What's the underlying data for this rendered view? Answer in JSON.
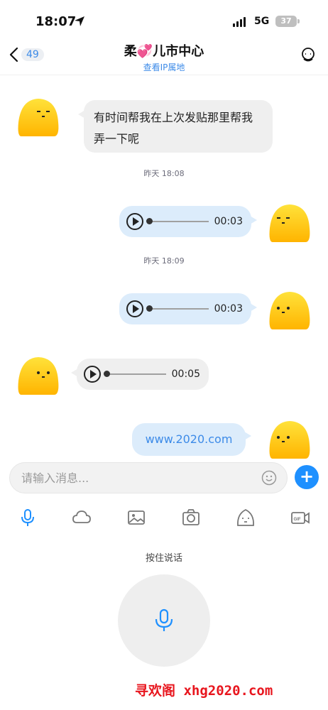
{
  "status_bar": {
    "time": "18:07",
    "network": "5G",
    "battery": "37"
  },
  "header": {
    "back_badge": "49",
    "title_prefix": "柔",
    "title_suffix": "儿市中心",
    "subtitle": "查看IP属地"
  },
  "messages": {
    "m1_text": "有时间帮我在上次发贴那里帮我弄一下呢",
    "ts1": "昨天 18:08",
    "voice1_duration": "00:03",
    "ts2": "昨天 18:09",
    "voice2_duration": "00:03",
    "voice3_duration": "00:05",
    "link_text": "www.2020.com"
  },
  "input": {
    "placeholder": "请输入消息..."
  },
  "toolbar": {
    "items": [
      "mic-icon",
      "cloud-icon",
      "image-icon",
      "camera-icon",
      "emoji-icon",
      "gif-icon"
    ],
    "active_color": "#1e90ff"
  },
  "voice_panel": {
    "hint": "按住说话"
  },
  "watermark": {
    "text": "寻欢阁 xhg2020.com"
  },
  "colors": {
    "accent": "#1e90ff",
    "bubble_mine": "#dcecfb",
    "bubble_theirs": "#efefef",
    "watermark": "#e8161e"
  }
}
